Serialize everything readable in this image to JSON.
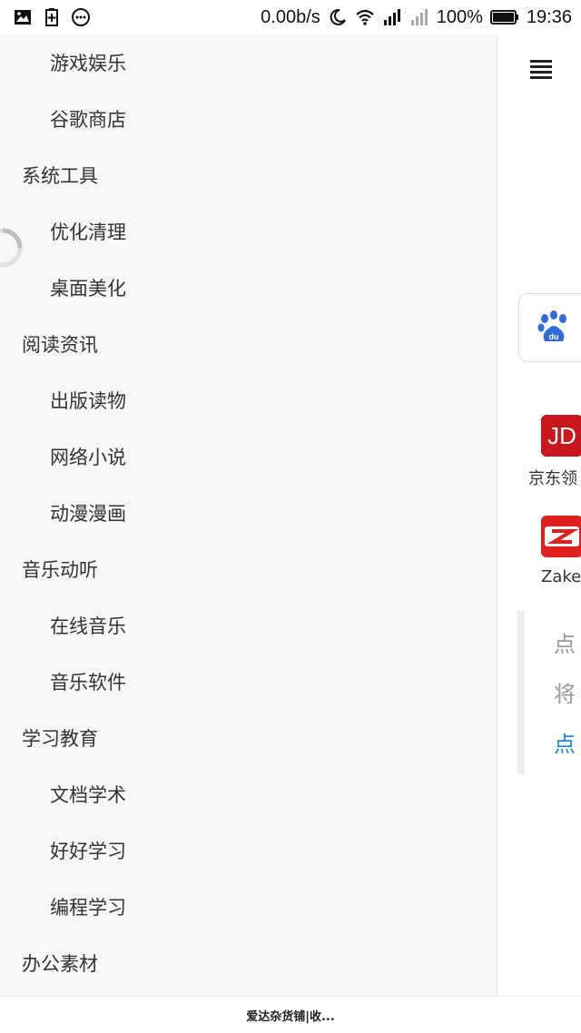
{
  "status_bar": {
    "speed": "0.00b/s",
    "battery": "100%",
    "time": "19:36",
    "icons": [
      "image-icon",
      "battery-plus-icon",
      "more-dots-icon",
      "moon-icon",
      "wifi-icon",
      "signal-icon",
      "signal-weak-icon",
      "battery-icon"
    ]
  },
  "drawer": {
    "items": [
      {
        "label": "游戏娱乐",
        "level": 2
      },
      {
        "label": "谷歌商店",
        "level": 2
      },
      {
        "label": "系统工具",
        "level": 1
      },
      {
        "label": "优化清理",
        "level": 2
      },
      {
        "label": "桌面美化",
        "level": 2
      },
      {
        "label": "阅读资讯",
        "level": 1
      },
      {
        "label": "出版读物",
        "level": 2
      },
      {
        "label": "网络小说",
        "level": 2
      },
      {
        "label": "动漫漫画",
        "level": 2
      },
      {
        "label": "音乐动听",
        "level": 1
      },
      {
        "label": "在线音乐",
        "level": 2
      },
      {
        "label": "音乐软件",
        "level": 2
      },
      {
        "label": "学习教育",
        "level": 1
      },
      {
        "label": "文档学术",
        "level": 2
      },
      {
        "label": "好好学习",
        "level": 2
      },
      {
        "label": "编程学习",
        "level": 2
      },
      {
        "label": "办公素材",
        "level": 1
      }
    ]
  },
  "content": {
    "apps": [
      {
        "name": "京东领",
        "tile_text": "JD",
        "color": "#c8161d"
      },
      {
        "name": "Zaker",
        "tile_text": "Z",
        "color": "#e0201f"
      }
    ],
    "notice": [
      "点",
      "将",
      "点"
    ]
  },
  "bottom_bar": {
    "title": "爱达杂货铺|收..."
  }
}
